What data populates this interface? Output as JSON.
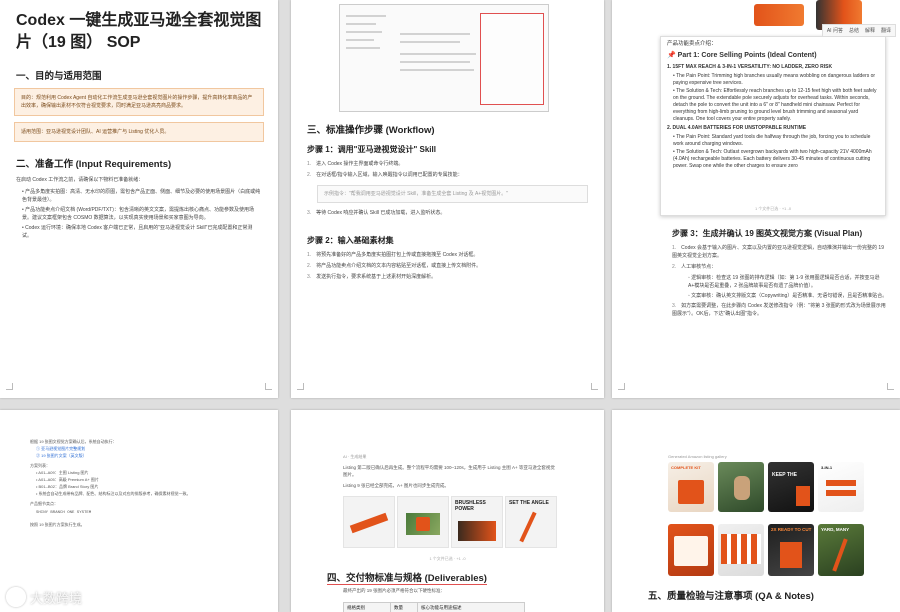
{
  "page1": {
    "title": "Codex 一键生成亚马逊全套视觉图片（19 图） SOP",
    "section1": "一、目的与适用范围",
    "purpose_box": "目的：规范利用 Codex Agent 自动化工作流生成亚马逊全套视觉图片的操作步骤，提升高转化率商品的产出效率，确保输出素材不仅符合视觉要求，同时满足亚马逊高亮商品要求。",
    "scope_box": "适用范围：亚马逊视觉设计团队、AI 运营推广与 Listing 优化人员。",
    "section2": "二、准备工作 (Input Requirements)",
    "intro": "在启动 Codex 工作流之前，请确保以下物料已准备就绪：",
    "bullets": [
      "产品多角度实拍图：高清、无水印的原图，需包含产品正面、侧面、细节及必要的使用场景图片（白底或纯色背景最佳）。",
      "产品功能卖点介绍文档 (Word/PDF/TXT)：包含清晰的英文文案，需提炼出核心痛点、功能参数及使用场景。建议文案框架包含 COSMO 数据算法，以实现真实使用场景和买家意图为导向。",
      "Codex 运行环境：确保本地 Codex 客户端已正常，且启用的\"亚马逊视觉设计 Skill\"已完成配置和正常测试。"
    ]
  },
  "page2": {
    "section3": "三、标准操作步骤 (Workflow)",
    "step1": "步骤 1：调用\"亚马逊视觉设计\" Skill",
    "step1_items": [
      "进入 Codex 操作主界面或命令行终端。",
      "在对话框/指令输入区域，输入唤醒指令以调用已配置的专属技能："
    ],
    "prompt": "示例指令：\"帮我调用亚马逊视觉设计 Skill，准备生成全套 Listing 及 A+视觉图片。\"",
    "step1_item3": "等待 Codex 响应并确认 Skill 已成功加载，进入监听状态。",
    "step2": "步骤 2：输入基础素材集",
    "step2_items": [
      "将预先准备好的产品多角度实拍图打包上传或直接拖拽至 Codex 对话框。",
      "将产品功能卖点介绍文档的文本内容粘贴至对话框，或直接上传文档附件。",
      "发送执行指令，要求系统基于上述素材开始深度解析。"
    ]
  },
  "page3": {
    "popup_heading": "产品功能卖点介绍：",
    "part1": "Part 1: Core Selling Points (Ideal Content)",
    "toolbar": [
      "AI 问答",
      "总结",
      "解释",
      "翻译"
    ],
    "point1": "1. 15FT MAX REACH & 3-IN-1 VERSATILITY: NO LADDER, ZERO RISK",
    "point1_bullets": [
      "The Pain Point: Trimming high branches usually means wobbling on dangerous ladders or paying expensive tree services.",
      "The Solution & Tech: Effortlessly reach branches up to 12-15 feet high with both feet safely on the ground. The extendable pole securely adjusts for overhead tasks. Within seconds, detach the pole to convert the unit into a 6\" or 8\" handheld mini chainsaw. Perfect for everything from high-limb pruning to ground level brush trimming and seasonal yard cleanups. One tool covers your entire property safely."
    ],
    "point2": "2. DUAL 4.0AH BATTERIES FOR UNSTOPPABLE RUNTIME",
    "point2_bullets": [
      "The Pain Point: Standard yard tools die halfway through the job, forcing you to schedule work around charging windows.",
      "The Solution & Tech: Outlast overgrown backyards with two high-capacity 21V 4000mAh (4.0Ah) rechargeable batteries. Each battery delivers 30-45 minutes of continuous cutting power. Swap one while the other charges to ensure zero"
    ],
    "pager": "1 个文件已选 · +1 -0",
    "step3": "步骤 3：生成并确认 19 图英文视觉方案 (Visual Plan)",
    "step3_items": [
      "Codex 会基于输入的图片、文案以及内置的亚马逊视觉逻辑，自动推演并输出一份完整的 19 图英文视觉企划方案。",
      "人工审核节点："
    ],
    "review_bullets": [
      "逻辑审核：检查这 19 张图的排布逻辑（如：第 1-9 张用图逻辑是否合适，并按亚马逊 A+模块是否是重叠，2 张品牌故事是否有遗了品牌价值）。",
      "文案审核：确认英文排版文案（Copywriting）是否精准、无语句错误，且是否精准贴合。"
    ],
    "step3_item3": "如方案需要调整，在此步骤向 Codex 发送修改指令（例：\"将第 3 张图的形式改为场景展示用图展示\"）。OK后，下达\"确认出图\"指令。"
  },
  "page4": {
    "intro": "根据 19 张图文视觉方案确认后，系统自动执行：",
    "links": [
      "① 亚马逊视觉图片完整规划",
      "② 19 张图片文案（英文版）"
    ],
    "label": "方案列表：",
    "list": [
      "A01–A09：主图 Listing 图片",
      "A01–A05：高级 Premium A+ 图片",
      "B01–B02：品牌 Brand Story 图片"
    ],
    "note": "系统会自动生成带有品牌、配色、结构标注以及对应的排版参考，确保素材视觉一致。",
    "sub_label": "产品细节卖点：",
    "key": "SHINY BRANCH ONE SYSTEM",
    "final": "按照 19 张图片方案执行生成。"
  },
  "page5": {
    "caption": "AI · 生成结果",
    "text": "Listing 第二版已确认后再生成。整个流程平均需要 100–120s，生成用于 Listing 主图 A+ 等亚马逊全套视觉图片。",
    "text2": "Listing 9 张已经全部完成，A+ 图片也同步生成完成。",
    "cards": [
      "",
      "BRUSHLESS POWER",
      "SET THE ANGLE",
      ""
    ],
    "pager": "1 个文件已选 · +1 -0",
    "section4": "四、交付物标准与规格 (Deliverables)",
    "section4_intro": "最终产出的 19 张图片必须严格符合以下硬性标准：",
    "table_headers": [
      "规格类别",
      "数量",
      "核心功能与用途描述"
    ]
  },
  "page6": {
    "caption": "Generated Amazon listing gallery",
    "tiles": [
      "COMPLETE KIT",
      "KEEP THE",
      "3-IN-1",
      "2X READY TO CUT",
      "YARD, MANY"
    ],
    "section5": "五、质量检验与注意事项 (QA & Notes)"
  },
  "watermark": "大数跨境"
}
